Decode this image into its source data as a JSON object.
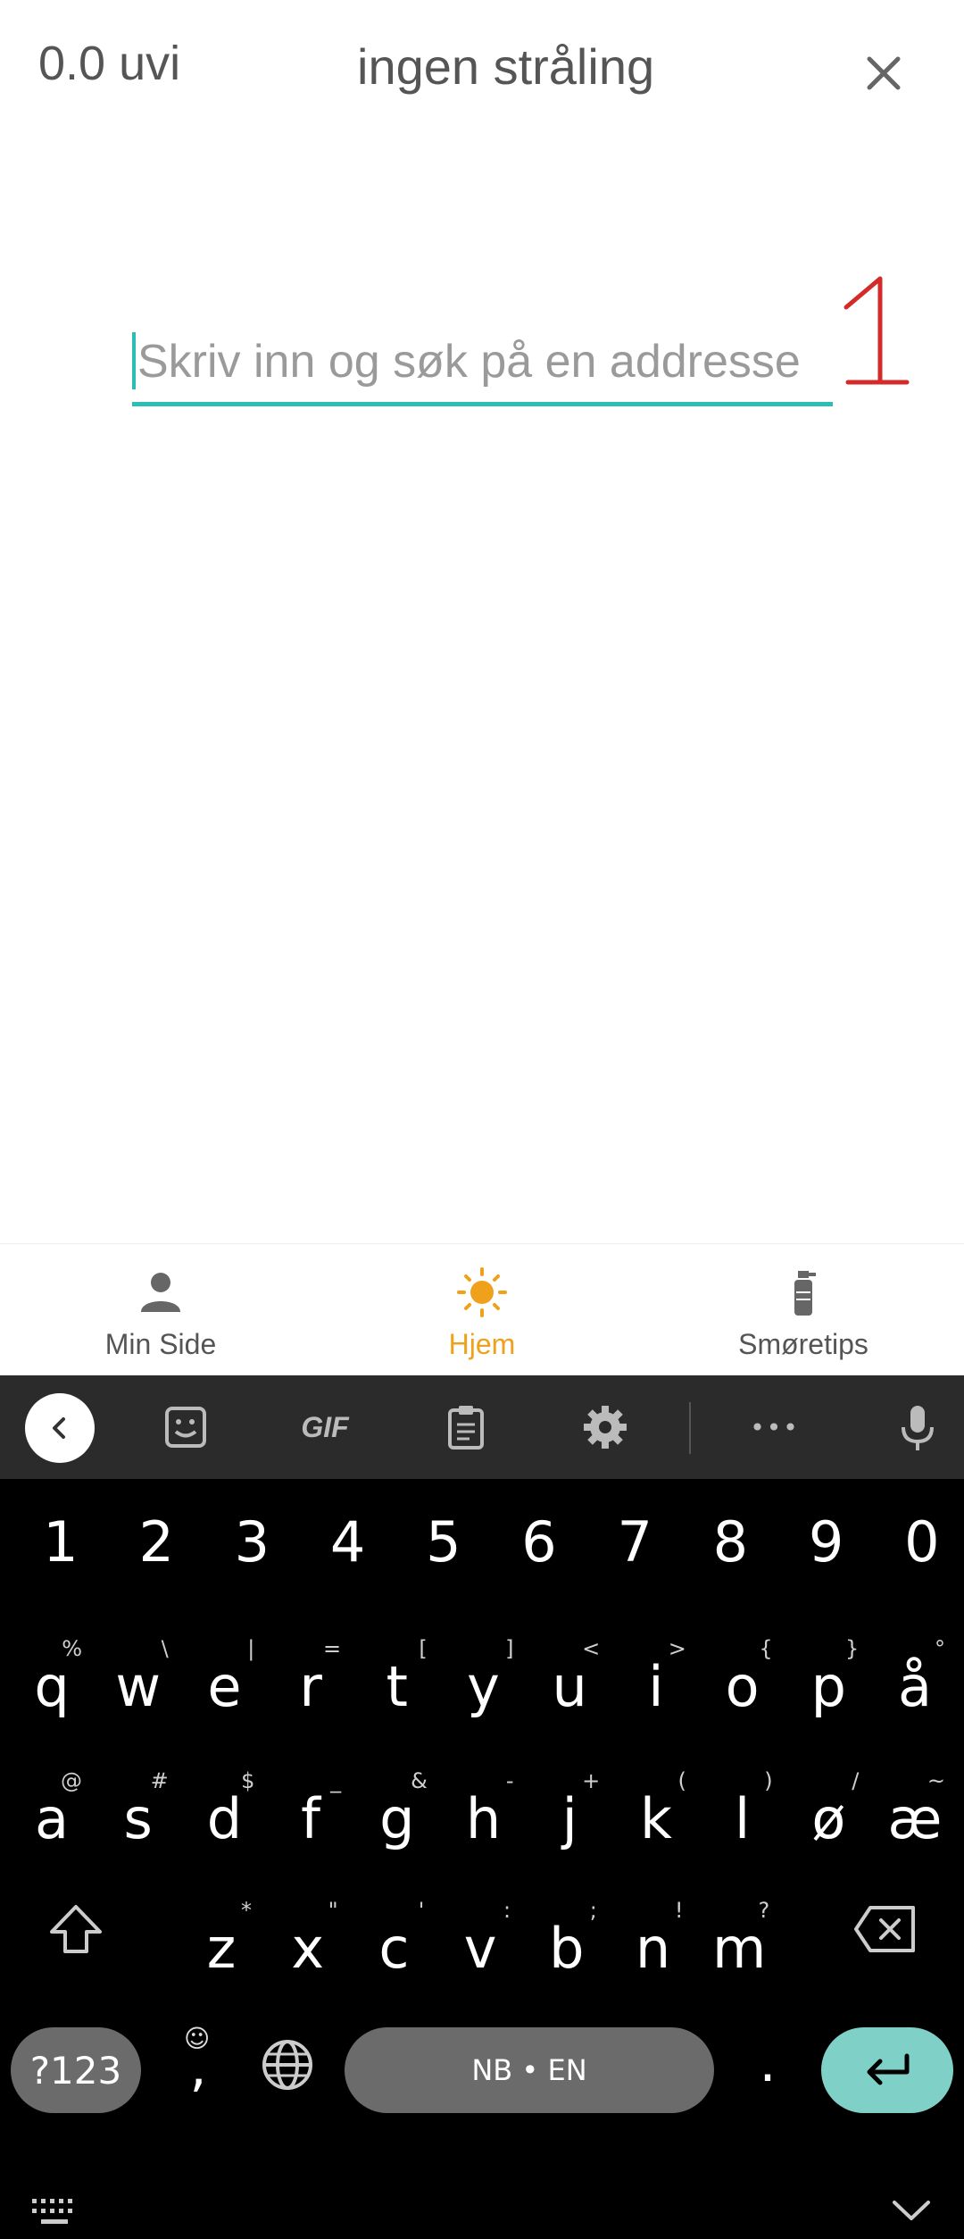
{
  "header": {
    "uvi": "0.0 uvi",
    "radiation": "ingen stråling"
  },
  "search": {
    "placeholder": "Skriv inn og søk på en addresse",
    "value": ""
  },
  "annotation_text": "1",
  "bottom_nav": [
    {
      "label": "Min Side",
      "icon": "person-icon",
      "active": false
    },
    {
      "label": "Hjem",
      "icon": "sun-icon",
      "active": true
    },
    {
      "label": "Smøretips",
      "icon": "sunscreen-bottle-icon",
      "active": false
    }
  ],
  "colors": {
    "accent_teal": "#2bbfb3",
    "active_orange": "#f0a11b",
    "keyboard_bg": "#000000",
    "keyboard_toolbar": "#2b2b2b"
  },
  "keyboard": {
    "toolbar_icons": [
      "back-arrow-icon",
      "sticker-icon",
      "gif-icon",
      "clipboard-icon",
      "settings-icon",
      "more-icon",
      "microphone-icon"
    ],
    "gif_label": "GIF",
    "more_label": "•••",
    "numbers": [
      "1",
      "2",
      "3",
      "4",
      "5",
      "6",
      "7",
      "8",
      "9",
      "0"
    ],
    "row1": [
      {
        "k": "q",
        "a": "%"
      },
      {
        "k": "w",
        "a": "\\"
      },
      {
        "k": "e",
        "a": "|"
      },
      {
        "k": "r",
        "a": "="
      },
      {
        "k": "t",
        "a": "["
      },
      {
        "k": "y",
        "a": "]"
      },
      {
        "k": "u",
        "a": "<"
      },
      {
        "k": "i",
        "a": ">"
      },
      {
        "k": "o",
        "a": "{"
      },
      {
        "k": "p",
        "a": "}"
      },
      {
        "k": "å",
        "a": "°"
      }
    ],
    "row2": [
      {
        "k": "a",
        "a": "@"
      },
      {
        "k": "s",
        "a": "#"
      },
      {
        "k": "d",
        "a": "$"
      },
      {
        "k": "f",
        "a": "_"
      },
      {
        "k": "g",
        "a": "&"
      },
      {
        "k": "h",
        "a": "-"
      },
      {
        "k": "j",
        "a": "+"
      },
      {
        "k": "k",
        "a": "("
      },
      {
        "k": "l",
        "a": ")"
      },
      {
        "k": "ø",
        "a": "/"
      },
      {
        "k": "æ",
        "a": "~"
      }
    ],
    "row3": [
      {
        "k": "z",
        "a": "*"
      },
      {
        "k": "x",
        "a": "\""
      },
      {
        "k": "c",
        "a": "'"
      },
      {
        "k": "v",
        "a": ":"
      },
      {
        "k": "b",
        "a": ";"
      },
      {
        "k": "n",
        "a": "!"
      },
      {
        "k": "m",
        "a": "?"
      }
    ],
    "symbols_label": "?123",
    "comma": ",",
    "comma_alt": "☺",
    "space_label": "NB • EN",
    "period": "."
  }
}
